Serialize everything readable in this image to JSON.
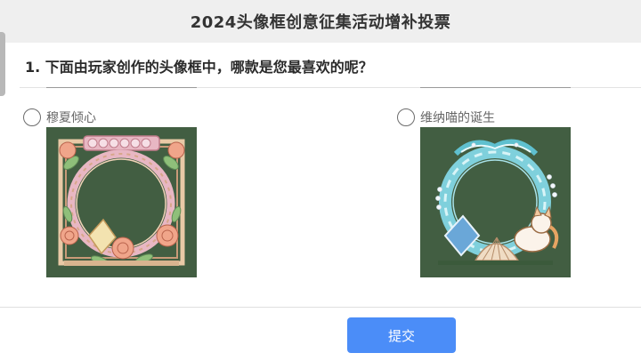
{
  "header": {
    "title": "2024头像框创意征集活动增补投票"
  },
  "question": {
    "title": "1. 下面由玩家创作的头像框中，哪款是您最喜欢的呢？",
    "options": [
      {
        "label": "穆夏倾心",
        "selected": false,
        "image": "floral-avatar-frame"
      },
      {
        "label": "维纳喵的诞生",
        "selected": false,
        "image": "seashell-cat-avatar-frame"
      }
    ]
  },
  "footer": {
    "submit_label": "提交"
  },
  "colors": {
    "accent": "#4b8df8",
    "image_background": "#425e42",
    "header_background": "#efefef"
  }
}
